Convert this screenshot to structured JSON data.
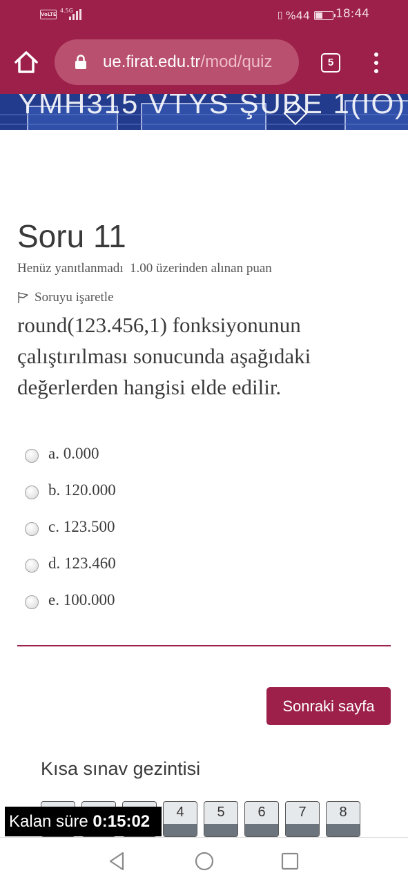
{
  "status_bar": {
    "volte": "VoLTE",
    "network": "4.5G",
    "battery_text": "%44",
    "battery_level": 0.44,
    "time": "18:44"
  },
  "browser": {
    "url_host": "ue.firat.edu.tr",
    "url_path": "/mod/quiz",
    "tab_count": "5"
  },
  "banner": {
    "title": "YMH315 VTYS ŞUBE 1(İÖ)"
  },
  "question": {
    "title": "Soru 11",
    "state": "Henüz yanıtlanmadı",
    "grade": "1.00 üzerinden alınan puan",
    "flag_label": "Soruyu işaretle",
    "text": "round(123.456,1) fonksiyonunun çalıştırılması sonucunda aşağıdaki değerlerden hangisi elde edilir."
  },
  "answers": [
    {
      "label": "a. 0.000"
    },
    {
      "label": "b. 120.000"
    },
    {
      "label": "c. 123.500"
    },
    {
      "label": "d. 123.460"
    },
    {
      "label": "e. 100.000"
    }
  ],
  "next_button": "Sonraki sayfa",
  "quiz_nav": {
    "title": "Kısa sınav gezintisi",
    "buttons": [
      "4",
      "5",
      "6",
      "7",
      "8"
    ]
  },
  "timer": {
    "label": "Kalan süre",
    "value": "0:15:02"
  },
  "colors": {
    "brand": "#9c2049",
    "banner": "#233b8d",
    "nav_bar_fill": "#6c757d"
  },
  "icons": {
    "home": "home-icon",
    "lock": "lock-icon",
    "menu": "more-vert-icon",
    "flag": "flag-icon",
    "back": "back-triangle-icon",
    "home_circle": "home-circle-icon",
    "recents": "recents-square-icon"
  }
}
